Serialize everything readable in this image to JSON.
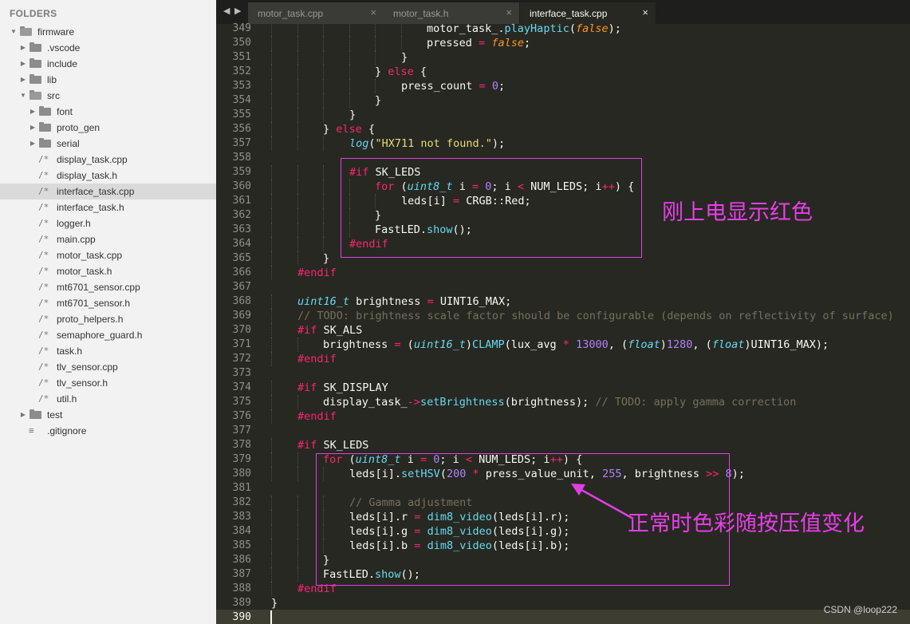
{
  "sidebar": {
    "header": "FOLDERS",
    "tree": [
      {
        "label": "firmware",
        "depth": 0,
        "kind": "folder",
        "open": true
      },
      {
        "label": ".vscode",
        "depth": 1,
        "kind": "folder",
        "open": false
      },
      {
        "label": "include",
        "depth": 1,
        "kind": "folder",
        "open": false
      },
      {
        "label": "lib",
        "depth": 1,
        "kind": "folder",
        "open": false
      },
      {
        "label": "src",
        "depth": 1,
        "kind": "folder",
        "open": true
      },
      {
        "label": "font",
        "depth": 2,
        "kind": "folder",
        "open": false
      },
      {
        "label": "proto_gen",
        "depth": 2,
        "kind": "folder",
        "open": false
      },
      {
        "label": "serial",
        "depth": 2,
        "kind": "folder",
        "open": false
      },
      {
        "label": "display_task.cpp",
        "depth": 2,
        "kind": "file"
      },
      {
        "label": "display_task.h",
        "depth": 2,
        "kind": "file"
      },
      {
        "label": "interface_task.cpp",
        "depth": 2,
        "kind": "file",
        "selected": true
      },
      {
        "label": "interface_task.h",
        "depth": 2,
        "kind": "file"
      },
      {
        "label": "logger.h",
        "depth": 2,
        "kind": "file"
      },
      {
        "label": "main.cpp",
        "depth": 2,
        "kind": "file"
      },
      {
        "label": "motor_task.cpp",
        "depth": 2,
        "kind": "file"
      },
      {
        "label": "motor_task.h",
        "depth": 2,
        "kind": "file"
      },
      {
        "label": "mt6701_sensor.cpp",
        "depth": 2,
        "kind": "file"
      },
      {
        "label": "mt6701_sensor.h",
        "depth": 2,
        "kind": "file"
      },
      {
        "label": "proto_helpers.h",
        "depth": 2,
        "kind": "file"
      },
      {
        "label": "semaphore_guard.h",
        "depth": 2,
        "kind": "file"
      },
      {
        "label": "task.h",
        "depth": 2,
        "kind": "file"
      },
      {
        "label": "tlv_sensor.cpp",
        "depth": 2,
        "kind": "file"
      },
      {
        "label": "tlv_sensor.h",
        "depth": 2,
        "kind": "file"
      },
      {
        "label": "util.h",
        "depth": 2,
        "kind": "file"
      },
      {
        "label": "test",
        "depth": 1,
        "kind": "folder",
        "open": false
      },
      {
        "label": ".gitignore",
        "depth": 1,
        "kind": "textfile"
      }
    ]
  },
  "tabs": [
    {
      "label": "motor_task.cpp",
      "active": false
    },
    {
      "label": "motor_task.h",
      "active": false
    },
    {
      "label": "interface_task.cpp",
      "active": true
    }
  ],
  "editor": {
    "first_line": 349,
    "current_line": 390,
    "lines": [
      {
        "indent": 6,
        "segs": [
          [
            "motor_task_.",
            ""
          ],
          [
            "playHaptic",
            "f"
          ],
          [
            "(",
            ""
          ],
          [
            "false",
            "it"
          ],
          [
            ");",
            ""
          ]
        ]
      },
      {
        "indent": 6,
        "segs": [
          [
            "pressed ",
            ""
          ],
          [
            "=",
            "k"
          ],
          [
            " ",
            ""
          ],
          [
            "false",
            "it"
          ],
          [
            ";",
            ""
          ]
        ]
      },
      {
        "indent": 5,
        "segs": [
          [
            "}",
            ""
          ]
        ]
      },
      {
        "indent": 4,
        "segs": [
          [
            "} ",
            ""
          ],
          [
            "else",
            "k"
          ],
          [
            " {",
            ""
          ]
        ]
      },
      {
        "indent": 5,
        "segs": [
          [
            "press_count ",
            ""
          ],
          [
            "=",
            "k"
          ],
          [
            " ",
            ""
          ],
          [
            "0",
            "n"
          ],
          [
            ";",
            ""
          ]
        ]
      },
      {
        "indent": 4,
        "segs": [
          [
            "}",
            ""
          ]
        ]
      },
      {
        "indent": 3,
        "segs": [
          [
            "}",
            ""
          ]
        ]
      },
      {
        "indent": 2,
        "segs": [
          [
            "} ",
            ""
          ],
          [
            "else",
            "k"
          ],
          [
            " {",
            ""
          ]
        ]
      },
      {
        "indent": 3,
        "segs": [
          [
            "log",
            "t"
          ],
          [
            "(",
            ""
          ],
          [
            "\"HX711 not found.\"",
            "s"
          ],
          [
            ");",
            ""
          ]
        ]
      },
      {
        "indent": 0,
        "segs": []
      },
      {
        "indent": 3,
        "segs": [
          [
            "#if",
            "k"
          ],
          [
            " SK_LEDS",
            ""
          ]
        ]
      },
      {
        "indent": 4,
        "segs": [
          [
            "for",
            "k"
          ],
          [
            " (",
            ""
          ],
          [
            "uint8_t",
            "t"
          ],
          [
            " i ",
            ""
          ],
          [
            "=",
            "k"
          ],
          [
            " ",
            ""
          ],
          [
            "0",
            "n"
          ],
          [
            "; i ",
            ""
          ],
          [
            "<",
            "k"
          ],
          [
            " NUM_LEDS; i",
            ""
          ],
          [
            "++",
            "k"
          ],
          [
            ") {",
            ""
          ]
        ]
      },
      {
        "indent": 5,
        "segs": [
          [
            "leds[i] ",
            ""
          ],
          [
            "=",
            "k"
          ],
          [
            " CRGB::Red;",
            ""
          ]
        ]
      },
      {
        "indent": 4,
        "segs": [
          [
            "}",
            ""
          ]
        ]
      },
      {
        "indent": 4,
        "segs": [
          [
            "FastLED.",
            ""
          ],
          [
            "show",
            "f"
          ],
          [
            "();",
            ""
          ]
        ]
      },
      {
        "indent": 3,
        "segs": [
          [
            "#endif",
            "k"
          ]
        ]
      },
      {
        "indent": 2,
        "segs": [
          [
            "}",
            ""
          ]
        ]
      },
      {
        "indent": 1,
        "segs": [
          [
            "#endif",
            "k"
          ]
        ]
      },
      {
        "indent": 0,
        "segs": []
      },
      {
        "indent": 1,
        "segs": [
          [
            "uint16_t",
            "t"
          ],
          [
            " brightness ",
            ""
          ],
          [
            "=",
            "k"
          ],
          [
            " UINT16_MAX;",
            ""
          ]
        ]
      },
      {
        "indent": 1,
        "segs": [
          [
            "// TODO: brightness scale factor should be configurable (depends on reflectivity of surface)",
            "c"
          ]
        ]
      },
      {
        "indent": 1,
        "segs": [
          [
            "#if",
            "k"
          ],
          [
            " SK_ALS",
            ""
          ]
        ]
      },
      {
        "indent": 2,
        "segs": [
          [
            "brightness ",
            ""
          ],
          [
            "=",
            "k"
          ],
          [
            " (",
            ""
          ],
          [
            "uint16_t",
            "t"
          ],
          [
            ")",
            ""
          ],
          [
            "CLAMP",
            "f"
          ],
          [
            "(lux_avg ",
            ""
          ],
          [
            "*",
            "k"
          ],
          [
            " ",
            ""
          ],
          [
            "13000",
            "n"
          ],
          [
            ", (",
            ""
          ],
          [
            "float",
            "t"
          ],
          [
            ")",
            ""
          ],
          [
            "1280",
            "n"
          ],
          [
            ", (",
            ""
          ],
          [
            "float",
            "t"
          ],
          [
            ")UINT16_MAX);",
            ""
          ]
        ]
      },
      {
        "indent": 1,
        "segs": [
          [
            "#endif",
            "k"
          ]
        ]
      },
      {
        "indent": 0,
        "segs": []
      },
      {
        "indent": 1,
        "segs": [
          [
            "#if",
            "k"
          ],
          [
            " SK_DISPLAY",
            ""
          ]
        ]
      },
      {
        "indent": 2,
        "segs": [
          [
            "display_task_",
            ""
          ],
          [
            "->",
            "k"
          ],
          [
            "setBrightness",
            "f"
          ],
          [
            "(brightness); ",
            ""
          ],
          [
            "// TODO: apply gamma correction",
            "c"
          ]
        ]
      },
      {
        "indent": 1,
        "segs": [
          [
            "#endif",
            "k"
          ]
        ]
      },
      {
        "indent": 0,
        "segs": []
      },
      {
        "indent": 1,
        "segs": [
          [
            "#if",
            "k"
          ],
          [
            " SK_LEDS",
            ""
          ]
        ]
      },
      {
        "indent": 2,
        "segs": [
          [
            "for",
            "k"
          ],
          [
            " (",
            ""
          ],
          [
            "uint8_t",
            "t"
          ],
          [
            " i ",
            ""
          ],
          [
            "=",
            "k"
          ],
          [
            " ",
            ""
          ],
          [
            "0",
            "n"
          ],
          [
            "; i ",
            ""
          ],
          [
            "<",
            "k"
          ],
          [
            " NUM_LEDS; i",
            ""
          ],
          [
            "++",
            "k"
          ],
          [
            ") {",
            ""
          ]
        ]
      },
      {
        "indent": 3,
        "segs": [
          [
            "leds[i].",
            ""
          ],
          [
            "setHSV",
            "f"
          ],
          [
            "(",
            ""
          ],
          [
            "200",
            "n"
          ],
          [
            " ",
            ""
          ],
          [
            "*",
            "k"
          ],
          [
            " press_value_unit, ",
            ""
          ],
          [
            "255",
            "n"
          ],
          [
            ", brightness ",
            ""
          ],
          [
            ">>",
            "k"
          ],
          [
            " ",
            ""
          ],
          [
            "8",
            "n"
          ],
          [
            ");",
            ""
          ]
        ]
      },
      {
        "indent": 0,
        "segs": []
      },
      {
        "indent": 3,
        "segs": [
          [
            "// Gamma adjustment",
            "c"
          ]
        ]
      },
      {
        "indent": 3,
        "segs": [
          [
            "leds[i].r ",
            ""
          ],
          [
            "=",
            "k"
          ],
          [
            " ",
            ""
          ],
          [
            "dim8_video",
            "f"
          ],
          [
            "(leds[i].r);",
            ""
          ]
        ]
      },
      {
        "indent": 3,
        "segs": [
          [
            "leds[i].g ",
            ""
          ],
          [
            "=",
            "k"
          ],
          [
            " ",
            ""
          ],
          [
            "dim8_video",
            "f"
          ],
          [
            "(leds[i].g);",
            ""
          ]
        ]
      },
      {
        "indent": 3,
        "segs": [
          [
            "leds[i].b ",
            ""
          ],
          [
            "=",
            "k"
          ],
          [
            " ",
            ""
          ],
          [
            "dim8_video",
            "f"
          ],
          [
            "(leds[i].b);",
            ""
          ]
        ]
      },
      {
        "indent": 2,
        "segs": [
          [
            "}",
            ""
          ]
        ]
      },
      {
        "indent": 2,
        "segs": [
          [
            "FastLED.",
            ""
          ],
          [
            "show",
            "f"
          ],
          [
            "();",
            ""
          ]
        ]
      },
      {
        "indent": 1,
        "segs": [
          [
            "#endif",
            "k"
          ]
        ]
      },
      {
        "indent": 0,
        "segs": [
          [
            "}",
            ""
          ]
        ]
      },
      {
        "indent": 0,
        "segs": []
      }
    ]
  },
  "annotations": {
    "note1": "刚上电显示红色",
    "note2": "正常时色彩随按压值变化",
    "color": "#e040e0"
  },
  "watermark": "CSDN @loop222",
  "colors": {
    "keyword": "#f92672",
    "function": "#66d9ef",
    "number": "#ae81ff",
    "string": "#e6db74",
    "type": "#66d9ef",
    "italic_const": "#fd971f",
    "comment": "#75715e",
    "text": "#f8f8f2",
    "background": "#272822"
  }
}
